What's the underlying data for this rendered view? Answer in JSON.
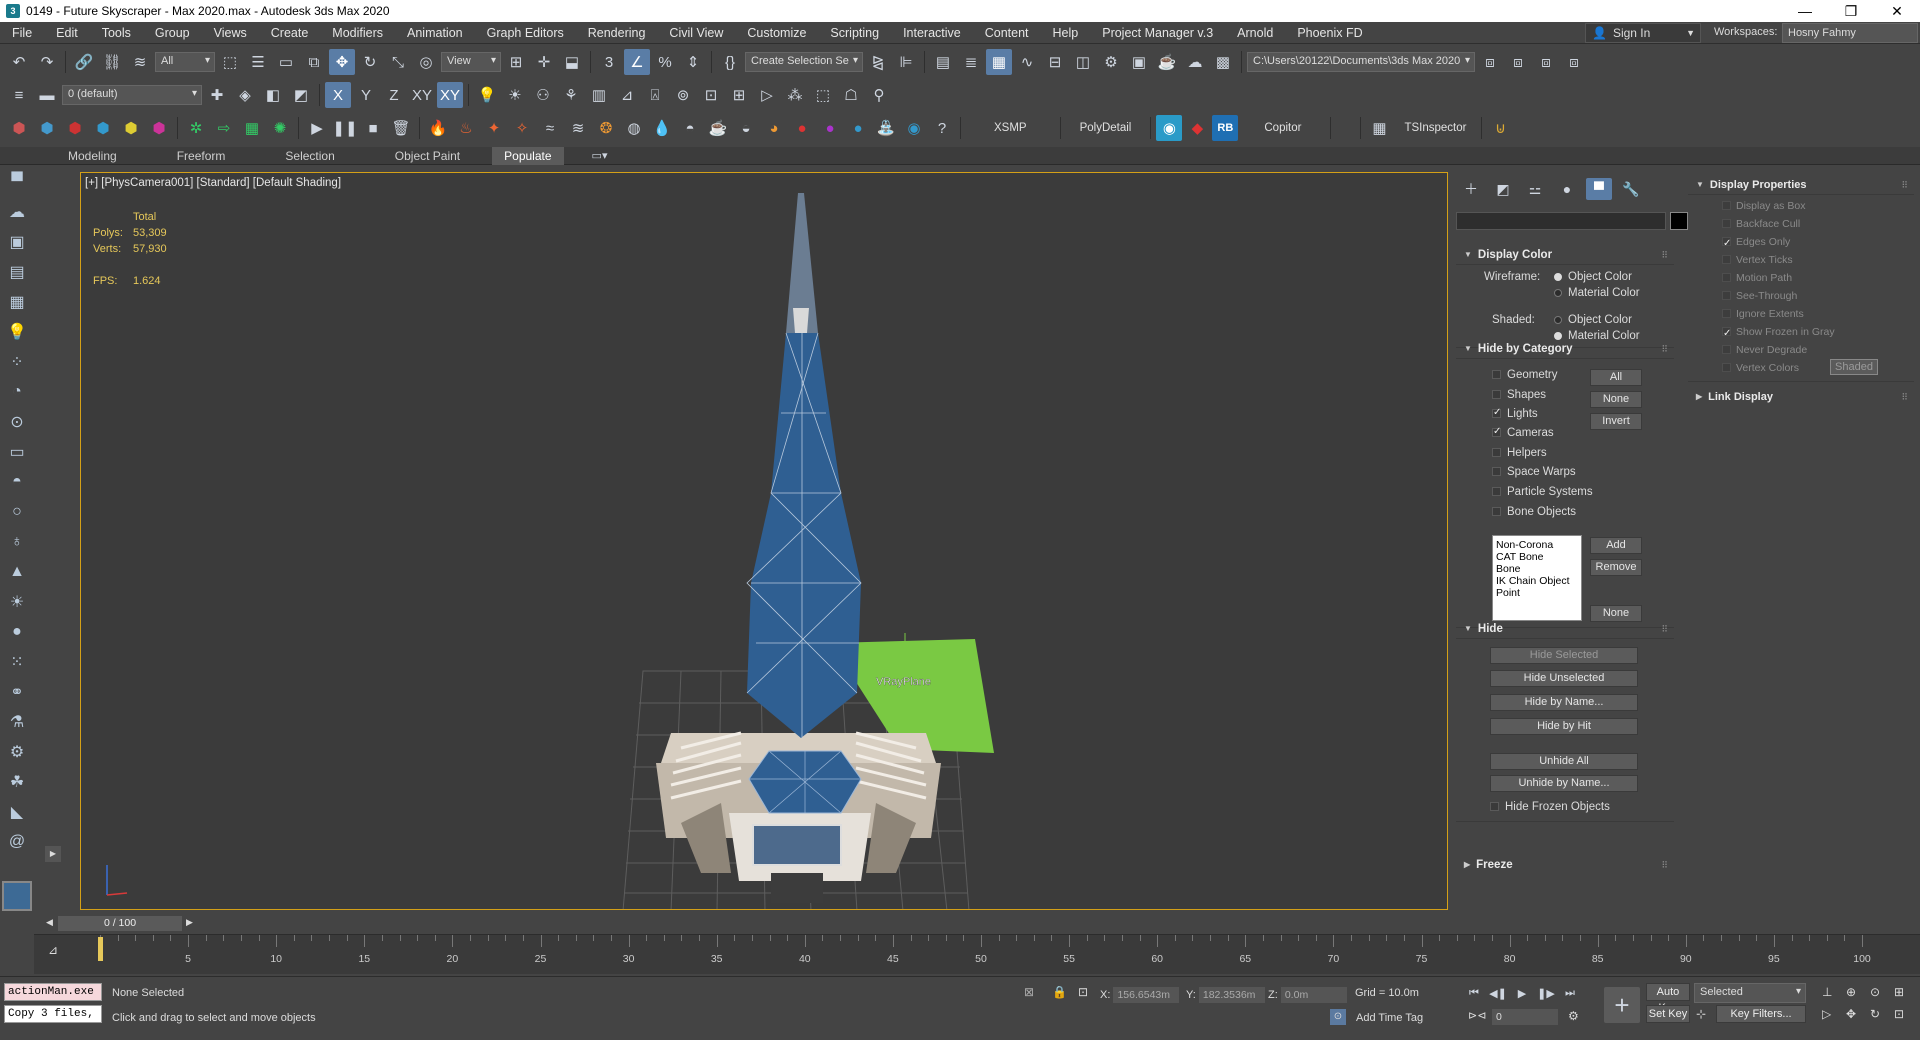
{
  "window": {
    "title": "0149 - Future Skyscraper - Max 2020.max - Autodesk 3ds Max 2020"
  },
  "menu": {
    "items": [
      "File",
      "Edit",
      "Tools",
      "Group",
      "Views",
      "Create",
      "Modifiers",
      "Animation",
      "Graph Editors",
      "Rendering",
      "Civil View",
      "Customize",
      "Scripting",
      "Interactive",
      "Content",
      "Help",
      "Project Manager v.3",
      "Arnold",
      "Phoenix FD"
    ],
    "sign_in": "Sign In",
    "workspaces_label": "Workspaces:",
    "workspace_value": "Hosny Fahmy"
  },
  "toolbar1": {
    "filter_value": "All",
    "refcoord_value": "View",
    "selection_set": "Create Selection Se",
    "project_path": "C:\\Users\\20122\\Documents\\3ds Max 2020"
  },
  "toolbar2": {
    "layer_value": "0 (default)"
  },
  "toolbar3": {
    "labels": [
      "XSMP",
      "PolyDetail",
      "Copitor",
      "TSInspector"
    ]
  },
  "ribbon": {
    "tabs": [
      "Modeling",
      "Freeform",
      "Selection",
      "Object Paint",
      "Populate"
    ],
    "active": "Populate"
  },
  "viewport": {
    "label": "[+] [PhysCamera001] [Standard] [Default Shading]",
    "stats_total": "Total",
    "polys_label": "Polys:",
    "polys_value": "53,309",
    "verts_label": "Verts:",
    "verts_value": "57,930",
    "fps_label": "FPS:",
    "fps_value": "1.624",
    "plane_label": "VRayPlane"
  },
  "display_panel": {
    "display_color": {
      "title": "Display Color",
      "wireframe_label": "Wireframe:",
      "shaded_label": "Shaded:",
      "object_color": "Object Color",
      "material_color": "Material Color"
    },
    "hide_by_category": {
      "title": "Hide by Category",
      "items": [
        {
          "label": "Geometry",
          "checked": false
        },
        {
          "label": "Shapes",
          "checked": false
        },
        {
          "label": "Lights",
          "checked": true
        },
        {
          "label": "Cameras",
          "checked": true
        },
        {
          "label": "Helpers",
          "checked": false
        },
        {
          "label": "Space Warps",
          "checked": false
        },
        {
          "label": "Particle Systems",
          "checked": false
        },
        {
          "label": "Bone Objects",
          "checked": false
        }
      ],
      "btn_all": "All",
      "btn_none": "None",
      "btn_invert": "Invert",
      "list": [
        "Non-Corona",
        "CAT Bone",
        "Bone",
        "IK Chain Object",
        "Point"
      ],
      "btn_add": "Add",
      "btn_remove": "Remove",
      "btn_none2": "None"
    },
    "hide": {
      "title": "Hide",
      "buttons": [
        "Hide Selected",
        "Hide Unselected",
        "Hide by Name...",
        "Hide by Hit",
        "Unhide All",
        "Unhide by Name..."
      ],
      "frozen_label": "Hide Frozen Objects"
    },
    "freeze_title": "Freeze",
    "display_properties": {
      "title": "Display Properties",
      "items": [
        {
          "label": "Display as Box",
          "checked": false
        },
        {
          "label": "Backface Cull",
          "checked": false
        },
        {
          "label": "Edges Only",
          "checked": true
        },
        {
          "label": "Vertex Ticks",
          "checked": false
        },
        {
          "label": "Motion Path",
          "checked": false
        },
        {
          "label": "See-Through",
          "checked": false
        },
        {
          "label": "Ignore Extents",
          "checked": false
        },
        {
          "label": "Show Frozen in Gray",
          "checked": true
        },
        {
          "label": "Never Degrade",
          "checked": false
        },
        {
          "label": "Vertex Colors",
          "checked": false
        }
      ],
      "shaded_btn": "Shaded"
    },
    "link_display_title": "Link Display"
  },
  "timeline": {
    "slider_text": "0 / 100",
    "ticks": [
      0,
      5,
      10,
      15,
      20,
      25,
      30,
      35,
      40,
      45,
      50,
      55,
      60,
      65,
      70,
      75,
      80,
      85,
      90,
      95,
      100
    ],
    "start": 0,
    "end": 100,
    "current": 0
  },
  "status": {
    "script1": "actionMan.exe",
    "script2": "Copy 3 files,",
    "selection": "None Selected",
    "prompt": "Click and drag to select and move objects",
    "x_label": "X:",
    "x_value": "156.6543m",
    "y_label": "Y:",
    "y_value": "182.3536m",
    "z_label": "Z:",
    "z_value": "0.0m",
    "grid": "Grid = 10.0m",
    "add_time_tag": "Add Time Tag",
    "auto_key": "Auto Key",
    "set_key": "Set Key",
    "key_mode": "Selected",
    "key_filters": "Key Filters...",
    "frame": "0"
  },
  "colors": {
    "accent": "#5a7da6",
    "viewport_border": "#d4a017",
    "stats": "#e6c85a",
    "plane": "#7ac943",
    "tower_blue": "#2f5f92"
  }
}
